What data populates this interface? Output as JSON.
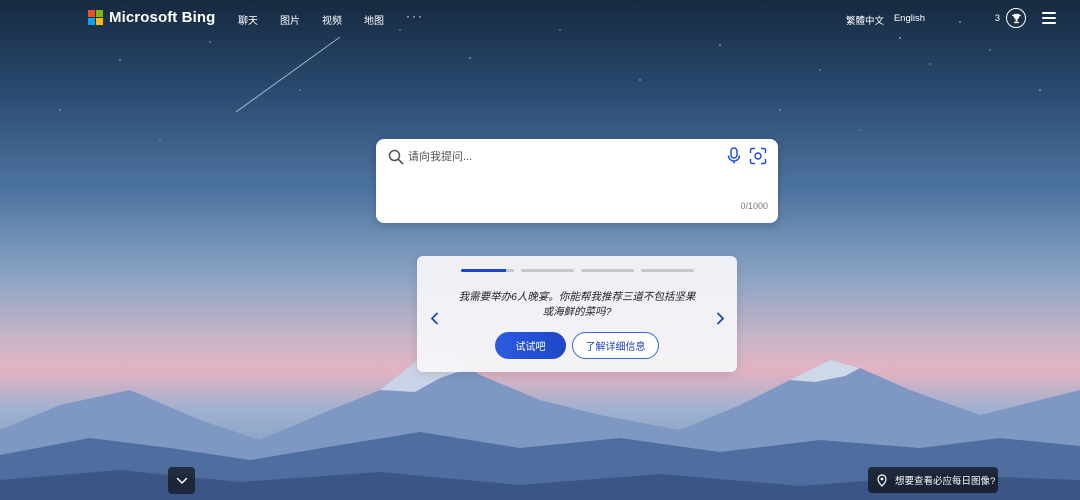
{
  "brand": {
    "name": "Microsoft Bing",
    "colors": [
      "#f25022",
      "#7fba00",
      "#00a4ef",
      "#ffb900"
    ]
  },
  "nav": {
    "items": [
      "聊天",
      "图片",
      "视频",
      "地图"
    ],
    "more": "···"
  },
  "header": {
    "lang_traditional": "繁體中文",
    "lang_english": "English",
    "points": "3",
    "rewards_icon": "trophy-icon",
    "menu_icon": "hamburger-icon"
  },
  "search": {
    "placeholder": "请向我提问...",
    "counter": "0/1000",
    "icons": [
      "search-icon",
      "microphone-icon",
      "visual-search-icon"
    ]
  },
  "suggestion": {
    "carousel_count": 4,
    "active_index": 0,
    "prompt": "我需要举办6人晚宴。你能帮我推荐三道不包括坚果或海鲜的菜吗?",
    "try_label": "试试吧",
    "learn_more_label": "了解详细信息"
  },
  "footer": {
    "image_info": "想要查看必应每日图像?"
  },
  "colors": {
    "accent": "#1f45c8",
    "sky_top": "#16293f",
    "pink_horizon": "#e3b3c3"
  }
}
